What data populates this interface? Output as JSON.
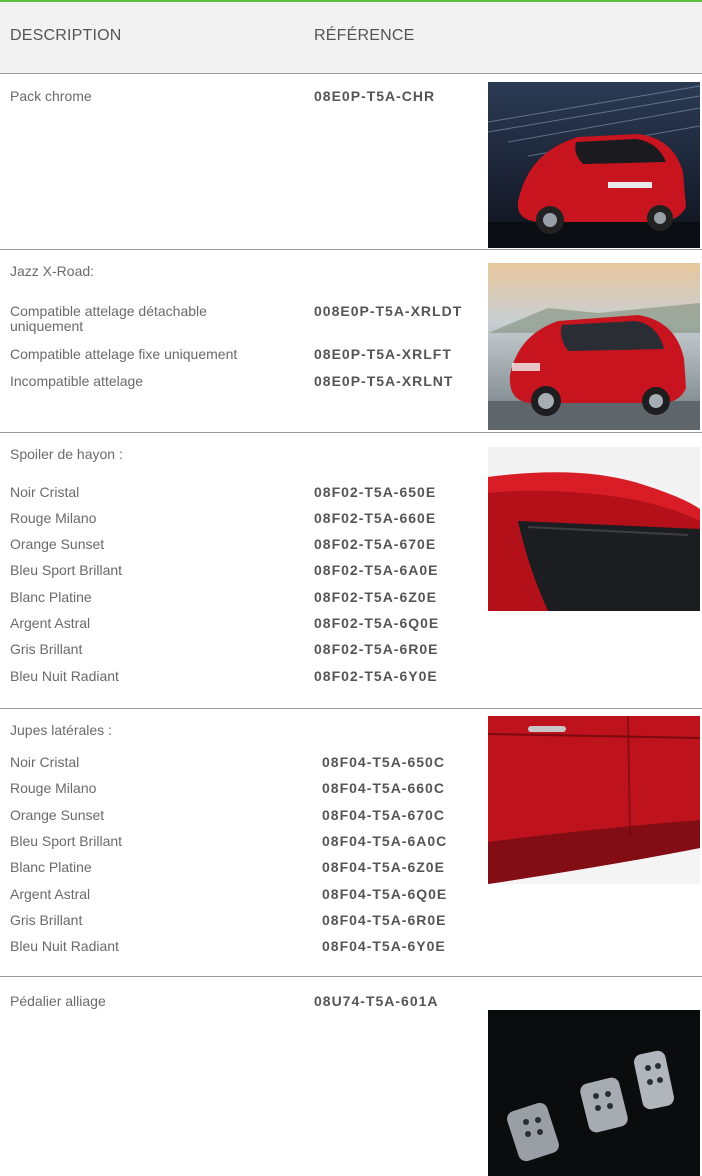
{
  "header": {
    "description": "DESCRIPTION",
    "reference": "RÉFÉRENCE"
  },
  "items": [
    {
      "title": "Pack chrome",
      "rows": [
        {
          "label": "",
          "ref": "08E0P-T5A-CHR"
        }
      ],
      "image": "red-hatchback-rear-photo"
    },
    {
      "title": "Jazz X-Road:",
      "rows": [
        {
          "label": "Compatible attelage détachable uniquement",
          "ref": "008E0P-T5A-XRLDT"
        },
        {
          "label": "Compatible attelage fixe uniquement",
          "ref": "08E0P-T5A-XRLFT"
        },
        {
          "label": "Incompatible attelage",
          "ref": "08E0P-T5A-XRLNT"
        }
      ],
      "image": "red-crossover-front-photo"
    },
    {
      "title": "Spoiler de hayon :",
      "rows": [
        {
          "label": "Noir Cristal",
          "ref": "08F02-T5A-650E"
        },
        {
          "label": "Rouge Milano",
          "ref": "08F02-T5A-660E"
        },
        {
          "label": "Orange Sunset",
          "ref": "08F02-T5A-670E"
        },
        {
          "label": "Bleu Sport Brillant",
          "ref": "08F02-T5A-6A0E"
        },
        {
          "label": "Blanc Platine",
          "ref": "08F02-T5A-6Z0E"
        },
        {
          "label": "Argent Astral",
          "ref": "08F02-T5A-6Q0E"
        },
        {
          "label": "Gris Brillant",
          "ref": "08F02-T5A-6R0E"
        },
        {
          "label": "Bleu Nuit Radiant",
          "ref": "08F02-T5A-6Y0E"
        }
      ],
      "image": "tailgate-spoiler-photo"
    },
    {
      "title": "Jupes latérales :",
      "rows": [
        {
          "label": "Noir Cristal",
          "ref": "08F04-T5A-650C"
        },
        {
          "label": "Rouge Milano",
          "ref": "08F04-T5A-660C"
        },
        {
          "label": "Orange Sunset",
          "ref": "08F04-T5A-670C"
        },
        {
          "label": "Bleu Sport Brillant",
          "ref": "08F04-T5A-6A0C"
        },
        {
          "label": "Blanc Platine",
          "ref": "08F04-T5A-6Z0E"
        },
        {
          "label": "Argent Astral",
          "ref": "08F04-T5A-6Q0E"
        },
        {
          "label": "Gris Brillant",
          "ref": "08F04-T5A-6R0E"
        },
        {
          "label": "Bleu Nuit Radiant",
          "ref": "08F04-T5A-6Y0E"
        }
      ],
      "image": "side-skirt-photo"
    },
    {
      "title": "Pédalier alliage",
      "rows": [
        {
          "label": "",
          "ref": "08U74-T5A-601A"
        }
      ],
      "image": "alloy-pedals-photo"
    }
  ],
  "colors": {
    "accent_line": "#5bbf43",
    "header_bg": "#f2f2f2",
    "divider": "#9a9a9a",
    "text": "#6a6a6a",
    "ref_text": "#555555",
    "car_red": "#c8141e"
  }
}
